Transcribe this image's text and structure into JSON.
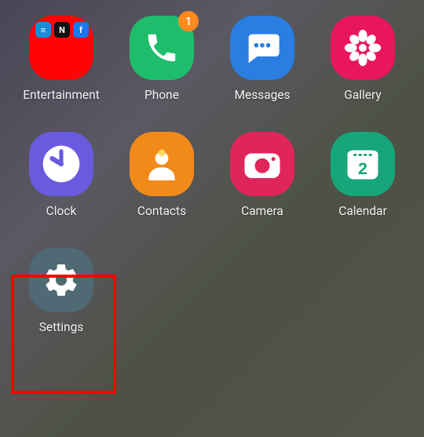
{
  "apps": [
    {
      "label": "Entertainment",
      "bg": "bg-red",
      "icon": "folder",
      "folder_items": [
        {
          "color": "#1a8cd8",
          "text": "≡"
        },
        {
          "color": "#111",
          "text": "N"
        },
        {
          "color": "#1877f2",
          "text": "f"
        }
      ]
    },
    {
      "label": "Phone",
      "bg": "bg-green",
      "icon": "phone",
      "badge": "1"
    },
    {
      "label": "Messages",
      "bg": "bg-blue",
      "icon": "messages"
    },
    {
      "label": "Gallery",
      "bg": "bg-pink",
      "icon": "gallery"
    },
    {
      "label": "Clock",
      "bg": "bg-purple",
      "icon": "clock"
    },
    {
      "label": "Contacts",
      "bg": "bg-orange",
      "icon": "contacts"
    },
    {
      "label": "Camera",
      "bg": "bg-crimson",
      "icon": "camera"
    },
    {
      "label": "Calendar",
      "bg": "bg-teal",
      "icon": "calendar",
      "calendar_day": "2"
    },
    {
      "label": "Settings",
      "bg": "bg-slate",
      "icon": "settings",
      "highlighted": true
    }
  ],
  "colors": {
    "badge": "#ff8a1f",
    "highlight": "#ff0000"
  }
}
